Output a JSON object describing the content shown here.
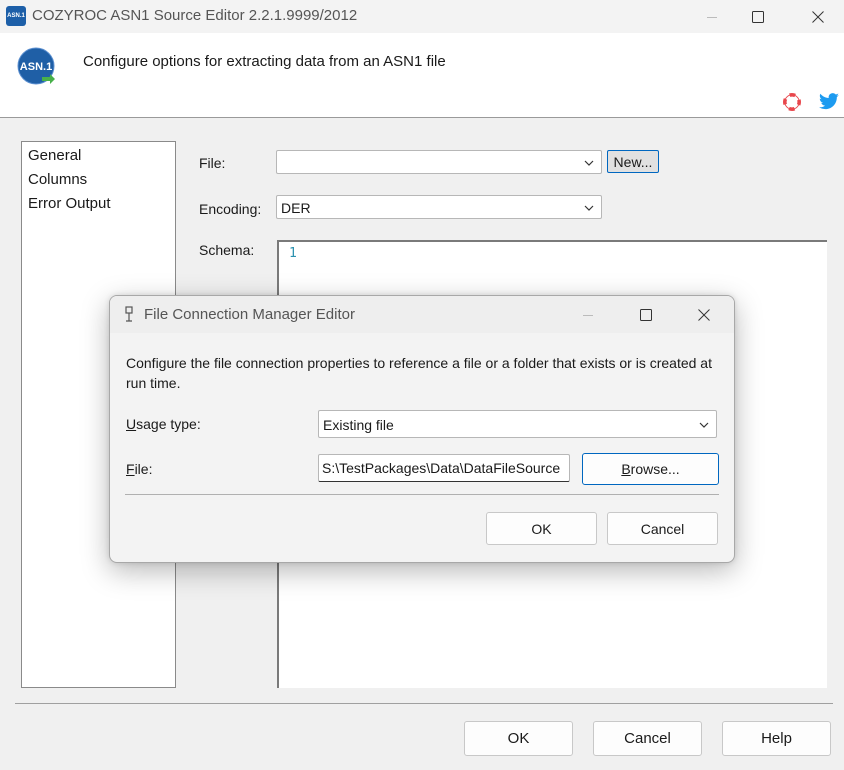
{
  "window": {
    "title": "COZYROC ASN1 Source Editor 2.2.1.9999/2012",
    "app_icon_text": "ASN.1"
  },
  "header": {
    "description": "Configure options for extracting data from an ASN1 file",
    "logo_text": "ASN.1"
  },
  "nav": {
    "items": [
      {
        "label": "General"
      },
      {
        "label": "Columns"
      },
      {
        "label": "Error Output"
      }
    ]
  },
  "form": {
    "file_label": "File:",
    "file_value": "",
    "new_button": "New...",
    "encoding_label": "Encoding:",
    "encoding_value": "DER",
    "schema_label": "Schema:",
    "schema_line_number": "1"
  },
  "footer": {
    "ok": "OK",
    "cancel": "Cancel",
    "help": "Help"
  },
  "dialog": {
    "title": "File Connection Manager Editor",
    "description": "Configure the file connection properties to reference a file or a folder that exists or is created at run time.",
    "usage_type_label_prefix": "U",
    "usage_type_label_rest": "sage type:",
    "usage_type_value": "Existing file",
    "file_label_prefix": "F",
    "file_label_rest": "ile:",
    "file_value": "S:\\TestPackages\\Data\\DataFileSource",
    "browse_prefix": "B",
    "browse_rest": "rowse...",
    "ok": "OK",
    "cancel": "Cancel"
  },
  "colors": {
    "accent": "#0067c0",
    "line_number": "#2b91af",
    "twitter": "#1d9bf0",
    "lifebuoy": "#e8474c"
  }
}
